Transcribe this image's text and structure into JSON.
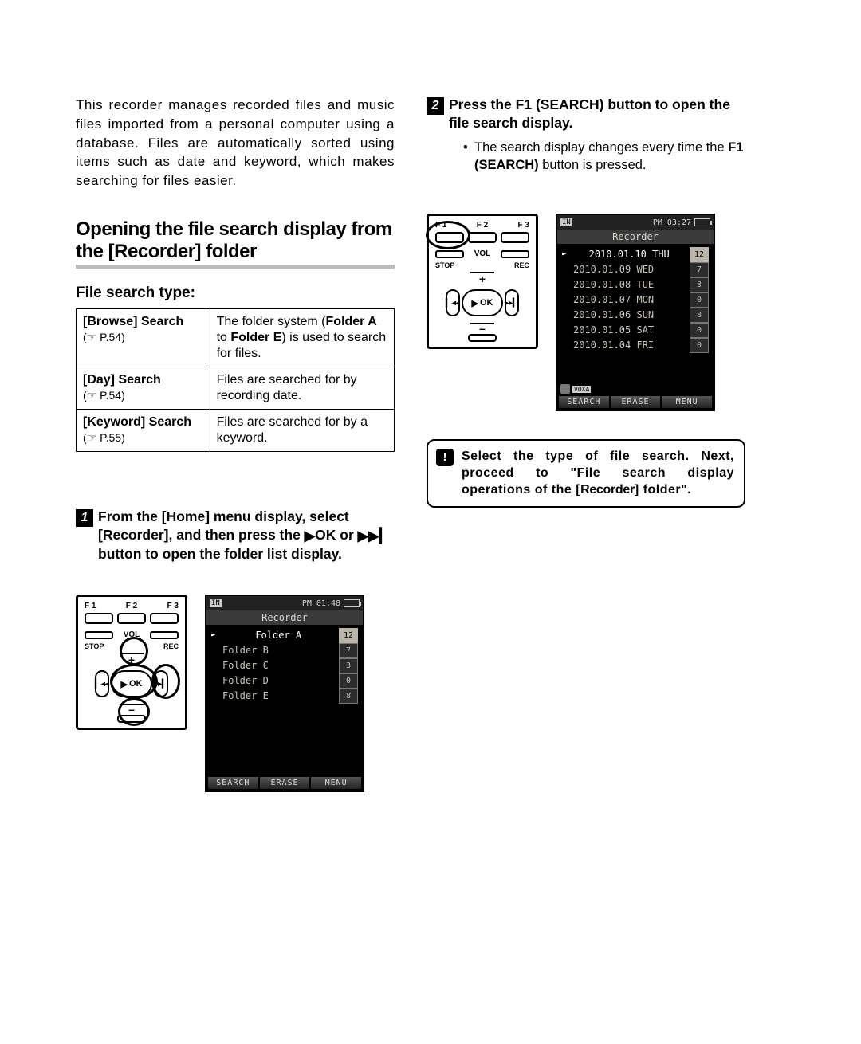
{
  "intro": "This recorder manages recorded files and music files imported from a personal computer using a database. Files are automatically sorted using items such as date and keyword, which makes searching for files easier.",
  "section_title": "Opening the file search display from the [Recorder] folder",
  "subhead": "File search type:",
  "search_types": [
    {
      "name": "[Browse] Search",
      "pref": "(☞ P.54)",
      "desc_a": "The folder system (",
      "desc_b": "Folder A",
      "desc_c": " to ",
      "desc_d": "Folder E",
      "desc_e": ") is used to search for files."
    },
    {
      "name": "[Day] Search",
      "pref": "(☞ P.54)",
      "desc_a": "Files are searched for by recording date.",
      "desc_b": "",
      "desc_c": "",
      "desc_d": "",
      "desc_e": ""
    },
    {
      "name": "[Keyword] Search",
      "pref": "(☞ P.55)",
      "desc_a": "Files are searched for by a keyword.",
      "desc_b": "",
      "desc_c": "",
      "desc_d": "",
      "desc_e": ""
    }
  ],
  "step1": {
    "num": "1",
    "text_a": "From the [",
    "text_b": "Home",
    "text_c": "] menu display, select [",
    "text_d": "Recorder",
    "text_e": "], and then press the ",
    "text_f": "OK",
    "text_g": " or ",
    "text_h": " button to open the folder list display."
  },
  "step2": {
    "num": "2",
    "text_a": "Press the ",
    "text_b": "F1 (SEARCH)",
    "text_c": " button to open the file search display.",
    "bullet_a": "The search display changes every time the ",
    "bullet_b": "F1 (SEARCH)",
    "bullet_c": " button is pressed."
  },
  "hw": {
    "f1": "F 1",
    "f2": "F 2",
    "f3": "F 3",
    "stop": "STOP",
    "vol": "VOL",
    "rec": "REC",
    "ok": "OK",
    "prev": "▎◂◂",
    "next": "▸▸▎"
  },
  "screen1": {
    "time": "PM 01:48",
    "title": "Recorder",
    "rows": [
      {
        "name": "Folder A",
        "count": "12",
        "sel": true
      },
      {
        "name": "Folder B",
        "count": "7"
      },
      {
        "name": "Folder C",
        "count": "3"
      },
      {
        "name": "Folder D",
        "count": "0"
      },
      {
        "name": "Folder E",
        "count": "8"
      }
    ],
    "sk": [
      "SEARCH",
      "ERASE",
      "MENU"
    ]
  },
  "screen2": {
    "time": "PM 03:27",
    "title": "Recorder",
    "rows": [
      {
        "name": "2010.01.10  THU",
        "count": "12",
        "sel": true
      },
      {
        "name": "2010.01.09  WED",
        "count": "7"
      },
      {
        "name": "2010.01.08  TUE",
        "count": "3"
      },
      {
        "name": "2010.01.07  MON",
        "count": "0"
      },
      {
        "name": "2010.01.06  SUN",
        "count": "8"
      },
      {
        "name": "2010.01.05  SAT",
        "count": "0"
      },
      {
        "name": "2010.01.04  FRI",
        "count": "0"
      }
    ],
    "sk": [
      "SEARCH",
      "ERASE",
      "MENU"
    ],
    "voxa": "VOXA"
  },
  "note": {
    "text_a": "Select the type of file search. Next, proceed to \"File search display operations of the [",
    "text_b": "Recorder",
    "text_c": "] folder\"."
  }
}
